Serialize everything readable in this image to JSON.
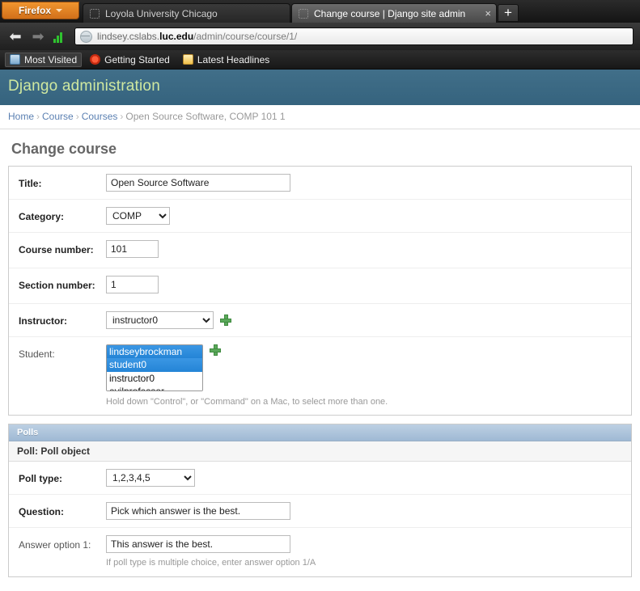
{
  "browser": {
    "firefox_button": {
      "label": "Firefox",
      "icon": "chevron-down-icon"
    },
    "tabs": [
      {
        "title": "Loyola University Chicago",
        "active": false
      },
      {
        "title": "Change course | Django site admin",
        "active": true
      }
    ],
    "tab_close_glyph": "×",
    "new_tab_glyph": "+",
    "nav": {
      "back_glyph": "⬅",
      "forward_glyph": "➡",
      "back_icon": "back-arrow-icon",
      "forward_icon": "forward-arrow-icon",
      "signal_icon": "signal-bars-icon"
    },
    "url": {
      "icon": "globe-icon",
      "subdomain": "lindsey.cslabs.",
      "domain": "luc.edu",
      "path": "/admin/course/course/1/",
      "full": "lindsey.cslabs.luc.edu/admin/course/course/1/"
    },
    "bookmarks": [
      {
        "label": "Most Visited",
        "icon": "most-visited-icon"
      },
      {
        "label": "Getting Started",
        "icon": "getting-started-icon"
      },
      {
        "label": "Latest Headlines",
        "icon": "rss-feed-icon"
      }
    ]
  },
  "site": {
    "header_title": "Django administration",
    "header_bg": "#3b6a85",
    "header_text_color": "#cfe8a0"
  },
  "breadcrumbs": {
    "separator": "›",
    "items": [
      {
        "label": "Home",
        "link": true
      },
      {
        "label": "Course",
        "link": true
      },
      {
        "label": "Courses",
        "link": true
      },
      {
        "label": "Open Source Software, COMP 101 1",
        "link": false
      }
    ]
  },
  "page": {
    "title": "Change course"
  },
  "course_form": {
    "rows": [
      {
        "label": "Title:",
        "type": "text",
        "value": "Open Source Software",
        "placeholder": ""
      },
      {
        "label": "Category:",
        "type": "select",
        "value": "COMP",
        "options": [
          "COMP"
        ]
      },
      {
        "label": "Course number:",
        "type": "text",
        "value": "101",
        "placeholder": ""
      },
      {
        "label": "Section number:",
        "type": "text",
        "value": "1",
        "placeholder": ""
      },
      {
        "label": "Instructor:",
        "type": "select-add",
        "value": "instructor0",
        "options": [
          "instructor0"
        ],
        "add_icon": "add-plus-icon"
      },
      {
        "label": "Student:",
        "type": "multiselect-add",
        "options": [
          "lindseybrockman",
          "student0",
          "instructor0",
          "evilprofessor"
        ],
        "selected": [
          "lindseybrockman",
          "student0"
        ],
        "add_icon": "add-plus-icon",
        "help": "Hold down \"Control\", or \"Command\" on a Mac, to select more than one."
      }
    ]
  },
  "polls_inline": {
    "heading": "Polls",
    "object_title": "Poll: Poll object",
    "rows": [
      {
        "label": "Poll type:",
        "type": "select",
        "value": "1,2,3,4,5",
        "options": [
          "1,2,3,4,5"
        ]
      },
      {
        "label": "Question:",
        "type": "text",
        "value": "Pick which answer is the best.",
        "placeholder": ""
      },
      {
        "label": "Answer option 1:",
        "type": "text",
        "value": "This answer is the best.",
        "placeholder": "",
        "help": "If poll type is multiple choice, enter answer option 1/A"
      }
    ]
  }
}
